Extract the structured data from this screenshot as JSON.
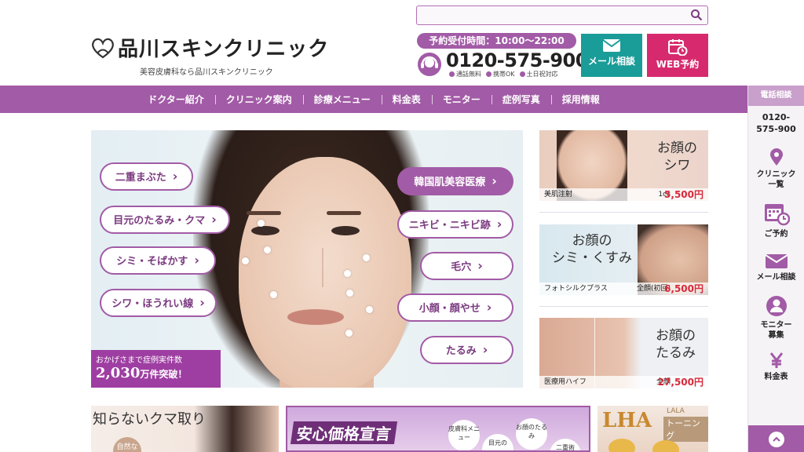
{
  "search": {
    "placeholder": ""
  },
  "logo": {
    "name": "品川スキンクリニック",
    "tagline": "美容皮膚科なら品川スキンクリニック"
  },
  "contact": {
    "reserve_hours": "予約受付時間：10:00〜22:00",
    "phone": "0120-575-900",
    "notes": [
      "通話無料",
      "携帯OK",
      "土日祝対応"
    ],
    "mail_label": "メール相談",
    "web_label": "WEB予約"
  },
  "nav": [
    "ドクター紹介",
    "クリニック案内",
    "診療メニュー",
    "料金表",
    "モニター",
    "症例写真",
    "採用情報"
  ],
  "sidebar": {
    "head": "電話相談",
    "tel_line1": "0120-",
    "tel_line2": "575-900",
    "items": [
      {
        "label1": "クリニック",
        "label2": "一覧",
        "icon": "map-pin-icon"
      },
      {
        "label1": "ご予約",
        "label2": "",
        "icon": "calendar-clock-icon"
      },
      {
        "label1": "メール相談",
        "label2": "",
        "icon": "mail-icon"
      },
      {
        "label1": "モニター",
        "label2": "募集",
        "icon": "person-icon"
      },
      {
        "label1": "料金表",
        "label2": "",
        "icon": "yen-icon"
      }
    ]
  },
  "hero": {
    "tags_left": [
      "二重まぶた",
      "目元のたるみ・クマ",
      "シミ・そばかす",
      "シワ・ほうれい線"
    ],
    "tags_right": [
      "韓国肌美容医療",
      "ニキビ・ニキビ跡",
      "毛穴",
      "小顔・顔やせ",
      "たるみ"
    ],
    "badge_line1": "おかげさまで症例実件数",
    "badge_number": "2,030",
    "badge_unit": "万件",
    "badge_tail": "突破！"
  },
  "banners": [
    {
      "title1": "お顔の",
      "title2": "シワ",
      "caption": "美肌注射",
      "pre": "1cc",
      "price": "5,500円"
    },
    {
      "title1": "お顔の",
      "title2": "シミ・くすみ",
      "caption": "フォトシルクプラス",
      "pre": "全顔(初回)",
      "price": "6,500円"
    },
    {
      "title1": "お顔の",
      "title2": "たるみ",
      "caption": "医療用ハイフ",
      "pre": "全顔",
      "price": "27,500円"
    }
  ],
  "bottom": {
    "b1_title": "知らないクマ取り",
    "b1_sub": "自然な",
    "b2_title": "安心価格宣言",
    "b2_c1": "皮膚科メニュー",
    "b2_c2": "目元の",
    "b2_c3": "お顔のたるみ",
    "b2_c4": "二重術",
    "b3_brand": "LHA",
    "b3_sub": "LALA",
    "b3_tail": "トーニング"
  },
  "colors": {
    "brand_purple": "#a25ba6",
    "mail_teal": "#1a9c98",
    "web_pink": "#d72a6e",
    "price_red": "#d72a3a"
  }
}
